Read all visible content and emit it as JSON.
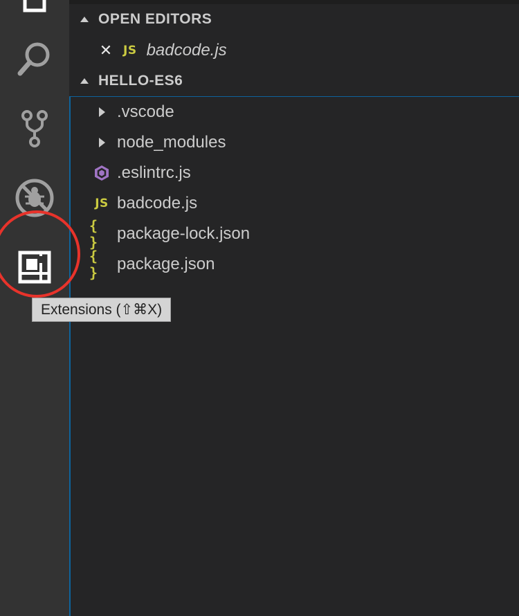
{
  "activity_bar": {
    "items": [
      {
        "name": "explorer-icon"
      },
      {
        "name": "search-icon"
      },
      {
        "name": "source-control-icon"
      },
      {
        "name": "debug-icon"
      },
      {
        "name": "extensions-icon"
      }
    ],
    "tooltip": "Extensions (⇧⌘X)"
  },
  "explorer": {
    "open_editors": {
      "title": "OPEN EDITORS",
      "items": [
        {
          "icon_text": "JS",
          "close_glyph": "✕",
          "label": "badcode.js"
        }
      ]
    },
    "project": {
      "title": "HELLO-ES6",
      "items": [
        {
          "type": "folder",
          "label": ".vscode"
        },
        {
          "type": "folder",
          "label": "node_modules"
        },
        {
          "type": "eslint",
          "label": ".eslintrc.js"
        },
        {
          "type": "js",
          "icon_text": "JS",
          "label": "badcode.js"
        },
        {
          "type": "json",
          "icon_text": "{ }",
          "label": "package-lock.json"
        },
        {
          "type": "json",
          "icon_text": "{ }",
          "label": "package.json"
        }
      ]
    }
  },
  "colors": {
    "activity_bar": "#333333",
    "sidebar": "#252526",
    "js_yellow": "#cbcb41",
    "eslint_purple": "#a074c4",
    "highlight_red": "#e8332b",
    "focus_blue": "#0e639c"
  }
}
